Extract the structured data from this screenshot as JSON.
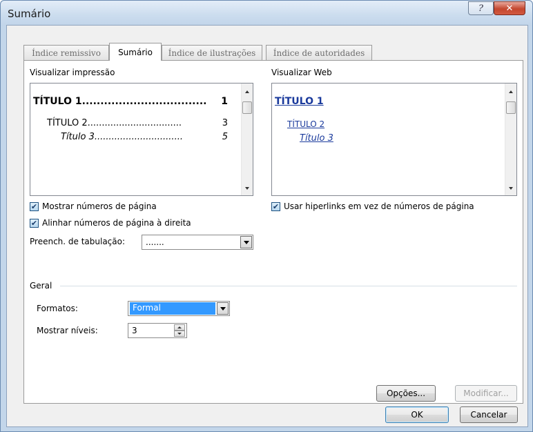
{
  "window": {
    "title": "Sumário",
    "help_symbol": "?",
    "close_symbol": "✕"
  },
  "tabs": [
    {
      "label": "Índice remissivo",
      "active": false
    },
    {
      "label": "Sumário",
      "active": true
    },
    {
      "label": "Índice de ilustrações",
      "active": false
    },
    {
      "label": "Índice de autoridades",
      "active": false
    }
  ],
  "print_preview": {
    "label": "Visualizar impressão",
    "entries": [
      {
        "text": "TÍTULO 1",
        "leader": "..................................",
        "page": "1"
      },
      {
        "text": "TÍTULO 2",
        "leader": ".................................",
        "page": "3"
      },
      {
        "text": "Título 3",
        "leader": "...............................",
        "page": "5"
      }
    ]
  },
  "web_preview": {
    "label": "Visualizar Web",
    "entries": [
      "TÍTULO 1",
      "TÍTULO 2",
      "Título 3"
    ]
  },
  "options": {
    "show_page_numbers": {
      "label": "Mostrar números de página",
      "checked": true
    },
    "right_align": {
      "label": "Alinhar números de página à direita",
      "checked": true
    },
    "use_hyperlinks": {
      "label": "Usar hiperlinks em vez de números de página",
      "checked": true
    },
    "tab_leader_label": "Preench. de tabulação:",
    "tab_leader_value": "......."
  },
  "general": {
    "label": "Geral",
    "formats_label": "Formatos:",
    "formats_value": "Formal",
    "levels_label": "Mostrar níveis:",
    "levels_value": "3"
  },
  "buttons": {
    "options": "Opções...",
    "modify": "Modificar...",
    "ok": "OK",
    "cancel": "Cancelar"
  },
  "colors": {
    "link": "#1a3a9c",
    "selection": "#3399ff"
  }
}
